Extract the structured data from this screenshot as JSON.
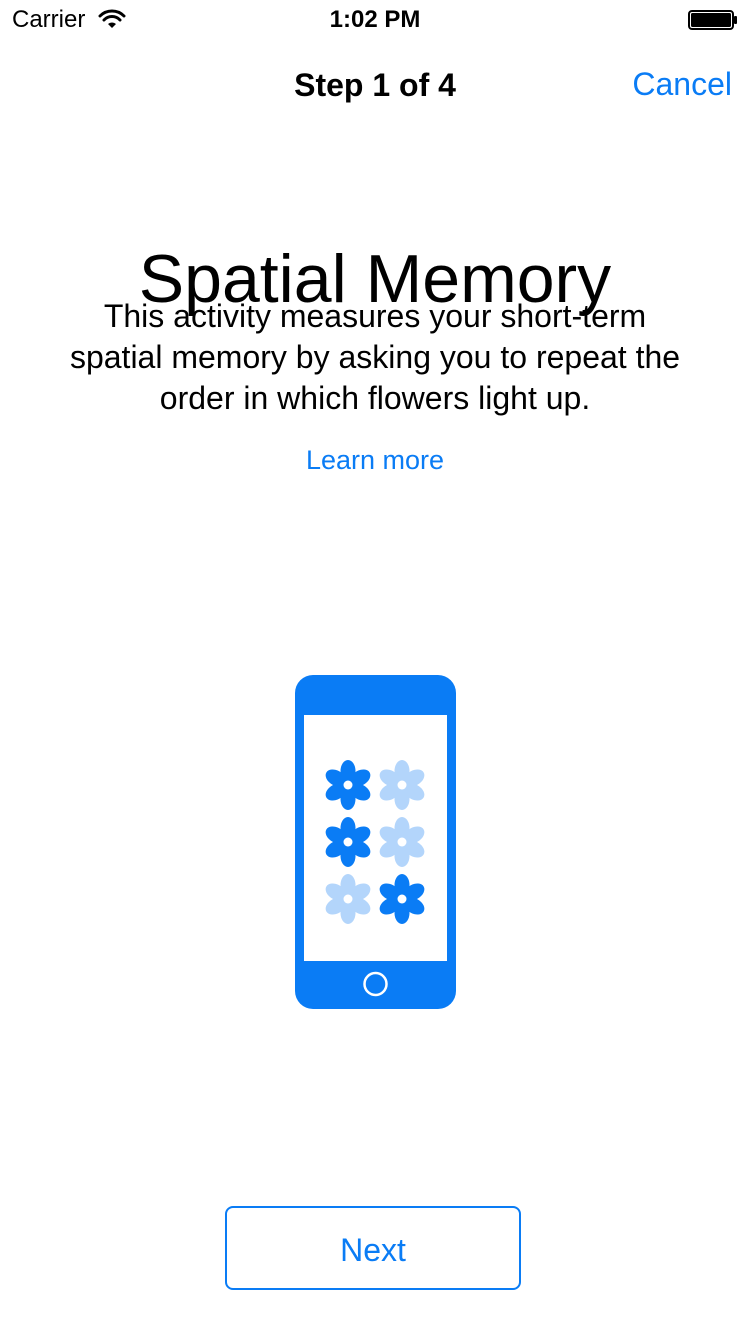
{
  "status_bar": {
    "carrier": "Carrier",
    "time": "1:02 PM",
    "icons": [
      "wifi-icon",
      "battery-icon"
    ]
  },
  "nav": {
    "title": "Step 1 of 4",
    "cancel_label": "Cancel"
  },
  "content": {
    "title": "Spatial Memory",
    "description": "This activity measures your short-term spatial memory by asking you to repeat the order in which flowers light up.",
    "learn_more_label": "Learn more"
  },
  "illustration": {
    "icon": "phone-with-flowers-icon",
    "flowers": [
      {
        "lit": true
      },
      {
        "lit": false
      },
      {
        "lit": true
      },
      {
        "lit": false
      },
      {
        "lit": false
      },
      {
        "lit": true
      }
    ]
  },
  "footer": {
    "next_label": "Next"
  },
  "colors": {
    "accent": "#0a7cf5",
    "flower_lit": "#0a7cf5",
    "flower_dim": "#b3d5fb",
    "background": "#ffffff",
    "text": "#000000"
  }
}
